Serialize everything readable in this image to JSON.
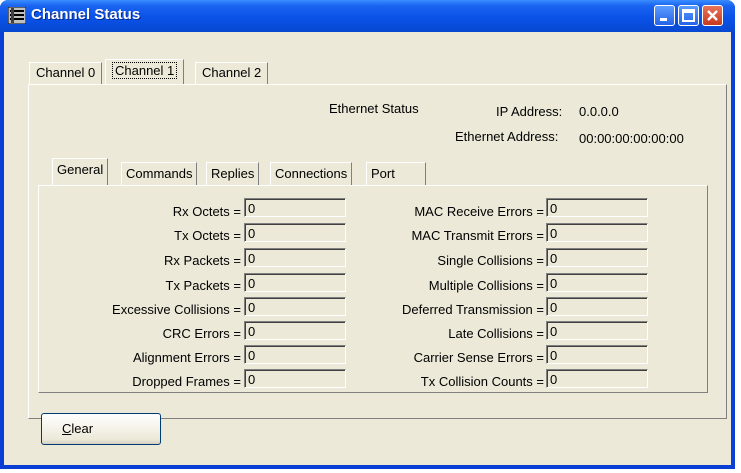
{
  "window": {
    "title": "Channel Status"
  },
  "outer_tabs": [
    {
      "label": "Channel 0",
      "selected": false
    },
    {
      "label": "Channel 1",
      "selected": true
    },
    {
      "label": "Channel 2",
      "selected": false
    }
  ],
  "ethernet": {
    "status_label": "Ethernet Status",
    "ip_label": "IP Address:",
    "ip_value": "0.0.0.0",
    "mac_label": "Ethernet Address:",
    "mac_value": "00:00:00:00:00:00"
  },
  "inner_tabs": [
    {
      "label": "General",
      "selected": true
    },
    {
      "label": "Commands",
      "selected": false
    },
    {
      "label": "Replies",
      "selected": false
    },
    {
      "label": "Connections",
      "selected": false
    },
    {
      "label": "Port",
      "selected": false
    }
  ],
  "left_fields": [
    {
      "label": "Rx Octets =",
      "value": "0"
    },
    {
      "label": "Tx Octets =",
      "value": "0"
    },
    {
      "label": "Rx Packets =",
      "value": "0"
    },
    {
      "label": "Tx Packets =",
      "value": "0"
    },
    {
      "label": "Excessive Collisions =",
      "value": "0"
    },
    {
      "label": "CRC Errors =",
      "value": "0"
    },
    {
      "label": "Alignment Errors =",
      "value": "0"
    },
    {
      "label": "Dropped Frames =",
      "value": "0"
    }
  ],
  "right_fields": [
    {
      "label": "MAC Receive Errors =",
      "value": "0"
    },
    {
      "label": "MAC Transmit Errors =",
      "value": "0"
    },
    {
      "label": "Single Collisions =",
      "value": "0"
    },
    {
      "label": "Multiple Collisions =",
      "value": "0"
    },
    {
      "label": "Deferred Transmission =",
      "value": "0"
    },
    {
      "label": "Late Collisions =",
      "value": "0"
    },
    {
      "label": "Carrier Sense Errors =",
      "value": "0"
    },
    {
      "label": "Tx Collision Counts =",
      "value": "0"
    }
  ],
  "clear_button": {
    "mnemonic": "C",
    "rest": "lear"
  }
}
